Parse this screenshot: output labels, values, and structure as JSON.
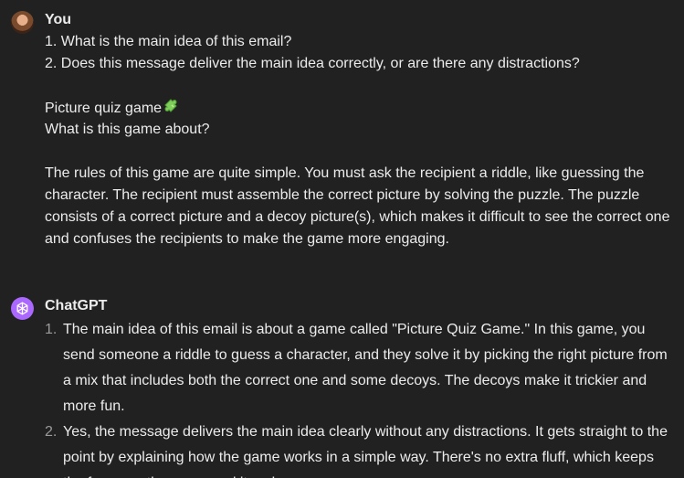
{
  "user": {
    "author": "You",
    "questions": "1. What is the main idea of this email?\n2. Does this message deliver the main idea correctly, or are there any distractions?",
    "game_title": "Picture quiz game",
    "game_question": "What is this game about?",
    "rules": "The rules of this game are quite simple. You must ask the recipient a riddle, like guessing the character. The recipient must assemble the correct picture by solving the puzzle. The puzzle consists of a correct picture and a decoy picture(s), which makes it difficult to see the correct one and confuses the recipients to make the game more engaging."
  },
  "assistant": {
    "author": "ChatGPT",
    "answers": [
      {
        "num": "1.",
        "text": "The main idea of this email is about a game called \"Picture Quiz Game.\" In this game, you send someone a riddle to guess a character, and they solve it by picking the right picture from a mix that includes both the correct one and some decoys. The decoys make it trickier and more fun."
      },
      {
        "num": "2.",
        "text": "Yes, the message delivers the main idea clearly without any distractions. It gets straight to the point by explaining how the game works in a simple way. There's no extra fluff, which keeps the focus on the game and its rules."
      }
    ]
  },
  "icons": {
    "user_avatar": "user-avatar-photo",
    "assistant_avatar": "openai-logo-icon",
    "puzzle": "puzzle-piece-icon"
  },
  "colors": {
    "background": "#212121",
    "text": "#ececec",
    "gpt_avatar": "#ab68ff",
    "puzzle": "#7fce5a"
  }
}
